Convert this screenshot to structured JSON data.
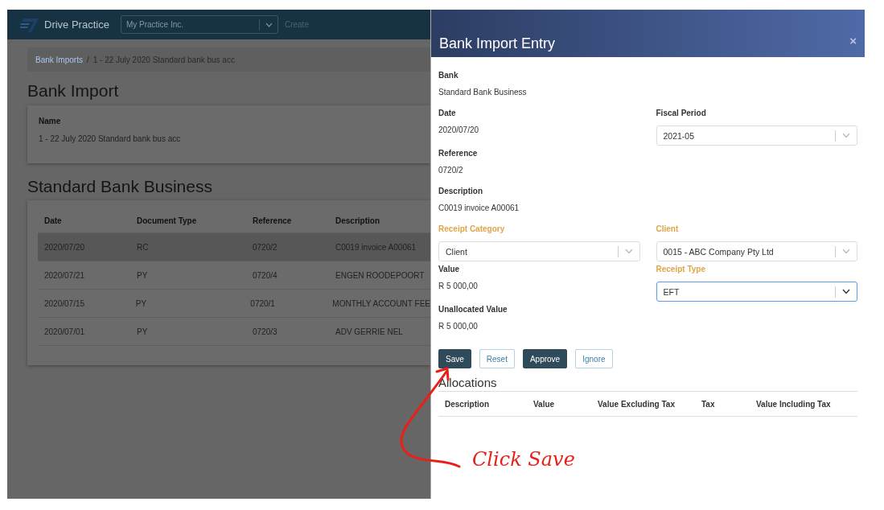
{
  "header": {
    "app_name": "Drive Practice",
    "company_select": "My Practice Inc.",
    "create_link": "Create"
  },
  "breadcrumb_separator": "/",
  "breadcrumb": [
    {
      "label": "Bank Imports",
      "link": true
    },
    {
      "label": "1 - 22 July 2020 Standard bank bus acc",
      "link": false
    }
  ],
  "page_title": "Bank Import",
  "name_card": {
    "label": "Name",
    "value": "1 - 22 July 2020 Standard bank bus acc"
  },
  "section_title": "Standard Bank Business",
  "table": {
    "columns": [
      "Date",
      "Document Type",
      "Reference",
      "Description"
    ],
    "rows": [
      {
        "cells": [
          "2020/07/20",
          "RC",
          "0720/2",
          "C0019 invoice A00061"
        ],
        "selected": true
      },
      {
        "cells": [
          "2020/07/21",
          "PY",
          "0720/4",
          "ENGEN ROODEPOORT"
        ],
        "selected": false
      },
      {
        "cells": [
          "2020/07/15",
          "PY",
          "0720/1",
          "MONTHLY ACCOUNT FEE"
        ],
        "selected": false
      },
      {
        "cells": [
          "2020/07/01",
          "PY",
          "0720/3",
          "ADV GERRIE NEL"
        ],
        "selected": false
      }
    ]
  },
  "drawer": {
    "title": "Bank Import Entry",
    "close": "×",
    "rows": [
      [
        {
          "label": "Bank",
          "kind": "text",
          "value": "Standard Bank Business",
          "required": false
        }
      ],
      [
        {
          "label": "Date",
          "kind": "text",
          "value": "2020/07/20",
          "required": false
        },
        {
          "label": "Fiscal Period",
          "kind": "select",
          "value": "2021-05",
          "required": false,
          "focused": false
        }
      ],
      [
        {
          "label": "Reference",
          "kind": "text",
          "value": "0720/2",
          "required": false
        }
      ],
      [
        {
          "label": "Description",
          "kind": "text",
          "value": "C0019 invoice A00061",
          "required": false
        }
      ],
      [
        {
          "label": "Receipt Category",
          "kind": "select",
          "value": "Client",
          "required": true,
          "focused": false
        },
        {
          "label": "Client",
          "kind": "select",
          "value": "0015 - ABC Company Pty Ltd",
          "required": true,
          "focused": false
        }
      ],
      [
        {
          "label": "Value",
          "kind": "text",
          "value": "R 5 000,00",
          "required": false
        },
        {
          "label": "Receipt Type",
          "kind": "select",
          "value": "EFT",
          "required": true,
          "focused": true
        }
      ],
      [
        {
          "label": "Unallocated Value",
          "kind": "text",
          "value": "R 5 000,00",
          "required": false
        }
      ]
    ],
    "buttons": [
      {
        "label": "Save",
        "kind": "primary"
      },
      {
        "label": "Reset",
        "kind": "outline"
      },
      {
        "label": "Approve",
        "kind": "primary"
      },
      {
        "label": "Ignore",
        "kind": "outline"
      }
    ],
    "allocations": {
      "title": "Allocations",
      "columns": [
        "Description",
        "Value",
        "Value Excluding Tax",
        "Tax",
        "Value Including Tax"
      ]
    }
  },
  "annotation": {
    "text": "Click Save"
  }
}
